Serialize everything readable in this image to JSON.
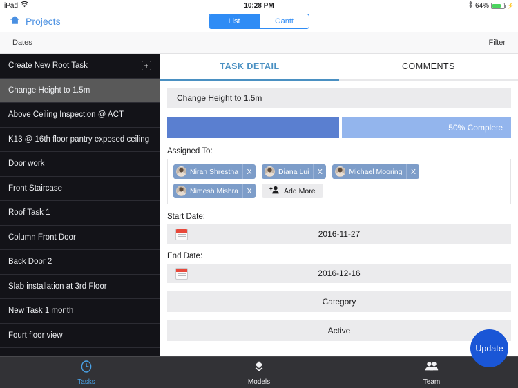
{
  "statusbar": {
    "device": "iPad",
    "wifi_icon": "wifi-icon",
    "time": "10:28 PM",
    "bluetooth_icon": "bluetooth-icon",
    "battery_percent": "64%",
    "battery_level": 64,
    "charging_icon": "charging-bolt-icon"
  },
  "navbar": {
    "home_icon": "home-icon",
    "home_label": "Projects",
    "segments": [
      {
        "label": "List",
        "active": true
      },
      {
        "label": "Gantt",
        "active": false
      }
    ]
  },
  "subbar": {
    "left_label": "Dates",
    "right_label": "Filter"
  },
  "sidebar": {
    "create_row": {
      "label": "Create New Root Task",
      "icon": "plus-square-icon"
    },
    "items": [
      {
        "label": "Change Height to 1.5m",
        "selected": true
      },
      {
        "label": "Above Ceiling Inspection @ ACT",
        "selected": false
      },
      {
        "label": "K13 @ 16th floor pantry exposed ceiling",
        "selected": false
      },
      {
        "label": "Door work",
        "selected": false
      },
      {
        "label": "Front Staircase",
        "selected": false
      },
      {
        "label": "Roof Task 1",
        "selected": false
      },
      {
        "label": "Column Front Door",
        "selected": false
      },
      {
        "label": "Back Door 2",
        "selected": false
      },
      {
        "label": "Slab installation at 3rd Floor",
        "selected": false
      },
      {
        "label": "New Task 1 month",
        "selected": false
      },
      {
        "label": "Fourt floor view",
        "selected": false
      },
      {
        "label": "Bonet",
        "selected": false
      }
    ]
  },
  "detail": {
    "tabs": [
      {
        "label": "TASK DETAIL",
        "active": true
      },
      {
        "label": "COMMENTS",
        "active": false
      }
    ],
    "task_title": "Change Height to 1.5m",
    "progress": {
      "percent": 50,
      "label": "50% Complete"
    },
    "assigned_label": "Assigned To:",
    "assignees": [
      {
        "name": "Niran Shrestha",
        "remove": "X"
      },
      {
        "name": "Diana Lui",
        "remove": "X"
      },
      {
        "name": "Michael Mooring",
        "remove": "X"
      },
      {
        "name": "Nimesh Mishra",
        "remove": "X"
      }
    ],
    "add_more": {
      "label": "Add More",
      "icon": "add-person-icon"
    },
    "start_date": {
      "label": "Start Date:",
      "value": "2016-11-27",
      "icon": "calendar-icon"
    },
    "end_date": {
      "label": "End Date:",
      "value": "2016-12-16",
      "icon": "calendar-icon"
    },
    "category": "Category",
    "status": "Active",
    "update_button": "Update"
  },
  "tabbar": {
    "items": [
      {
        "label": "Tasks",
        "icon": "clock-icon",
        "active": true
      },
      {
        "label": "Models",
        "icon": "cube-icon",
        "active": false
      },
      {
        "label": "Team",
        "icon": "people-icon",
        "active": false
      }
    ]
  },
  "colors": {
    "accent_blue": "#2f8cf5",
    "tab_blue": "#4a90c2",
    "fab_blue": "#1a56d6",
    "progress_done": "#5a7fd0",
    "progress_remain": "#93b5ed",
    "chip_blue": "#7d9dc9",
    "sidebar_bg": "#131318",
    "sidebar_selected": "#595959",
    "tabbar_bg": "#323236",
    "battery_green": "#4cd55f"
  }
}
